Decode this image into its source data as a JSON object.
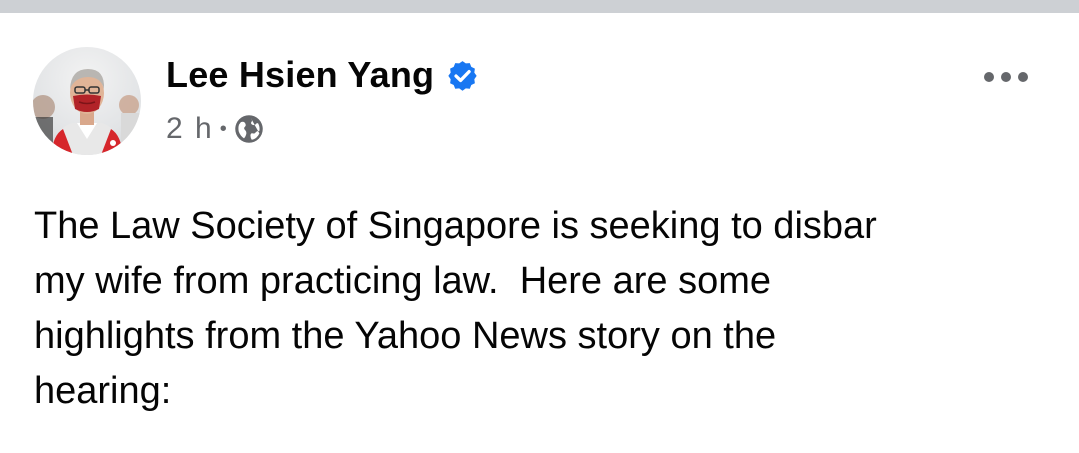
{
  "post": {
    "author": {
      "name": "Lee Hsien Yang",
      "verified": true
    },
    "meta": {
      "time": "2 h",
      "separator": "•",
      "audience_icon": "globe-icon"
    },
    "more_icon": "more-options-icon",
    "text_lines": [
      "The Law Society of Singapore is seeking to disbar",
      "my wife from practicing law.  Here are some",
      "highlights from the Yahoo News story on the",
      "hearing:"
    ]
  },
  "colors": {
    "top_strip": "#cdd0d4",
    "primary_text": "#050505",
    "secondary_text": "#65676b",
    "verified_badge": "#1877f2"
  }
}
